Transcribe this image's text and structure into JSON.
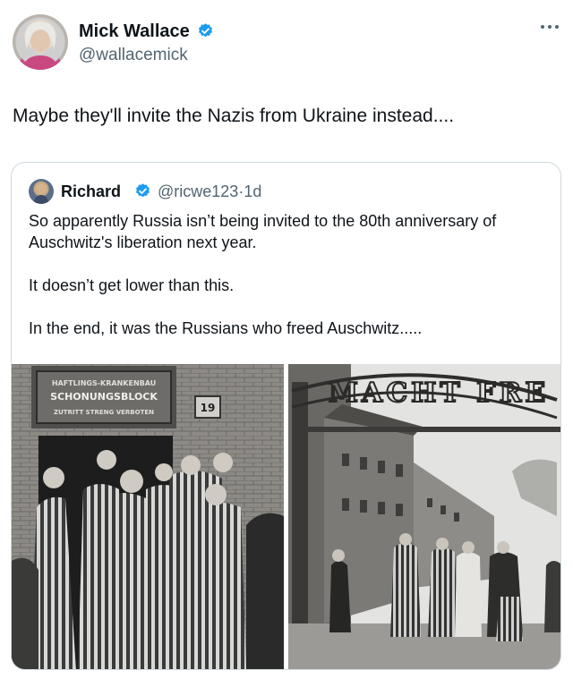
{
  "tweet": {
    "author": {
      "display_name": "Mick Wallace",
      "handle": "@wallacemick",
      "verified": true
    },
    "text": "Maybe they'll invite the Nazis from Ukraine instead....",
    "more_icon": "more-horizontal-icon",
    "quoted": {
      "author": {
        "display_name": "Richard",
        "handle": "@ricwe123",
        "time": "1d",
        "verified": true
      },
      "paragraphs": [
        "So apparently Russia isn’t being invited to the 80th anniversary of Auschwitz's liberation next year.",
        "It doesn’t get lower than this.",
        "In the end, it was the Russians who freed Auschwitz....."
      ],
      "photos": {
        "left": {
          "sign_line1": "HAFTLINGS-KRANKENBAU",
          "sign_line2": "SCHONUNGSBLOCK",
          "sign_line3": "ZUTRITT STRENG VERBOTEN",
          "block_number": "19"
        },
        "right": {
          "gate_text": "MACHT FRE"
        }
      }
    }
  },
  "colors": {
    "verified_blue": "#1d9bf0",
    "secondary_text": "#536471",
    "border": "#cfd9de"
  }
}
